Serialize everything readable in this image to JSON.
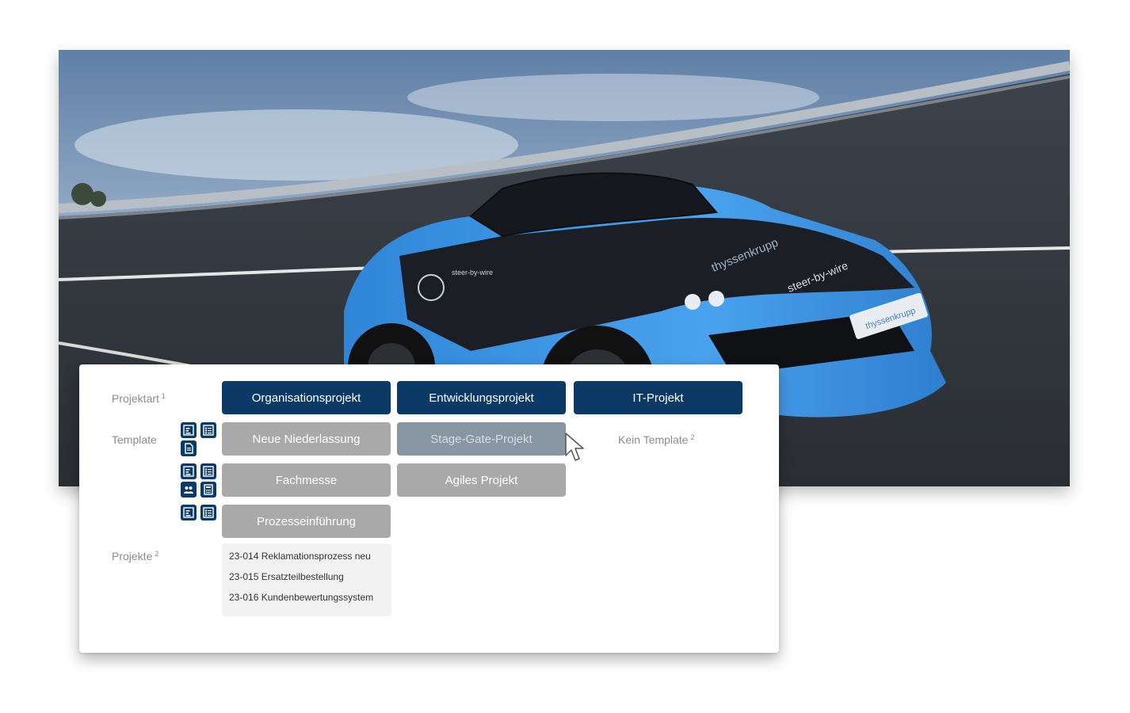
{
  "hero": {
    "car_hood_text": "thyssenkrupp",
    "car_side_text": "steer-by-wire",
    "plate_text": "thyssenkrupp"
  },
  "labels": {
    "projektart": "Projektart",
    "projektart_note": "1",
    "template": "Template",
    "projekte": "Projekte",
    "projekte_note": "2"
  },
  "project_types": [
    {
      "label": "Organisationsprojekt"
    },
    {
      "label": "Entwicklungsprojekt"
    },
    {
      "label": "IT-Projekt"
    }
  ],
  "templates": [
    {
      "label": "Neue Niederlassung"
    },
    {
      "label": "Stage-Gate-Projekt"
    },
    {
      "label": "Fachmesse"
    },
    {
      "label": "Agiles Projekt"
    },
    {
      "label": "Prozesseinführung"
    }
  ],
  "no_template": {
    "label": "Kein Template",
    "note": "2"
  },
  "projects": [
    "23-014 Reklamationsprozess neu",
    "23-015 Ersatzteilbestellung",
    "23-016 Kundenbewertungssystem"
  ],
  "colors": {
    "primary": "#0b3a66",
    "template_button": "#a9a9a9",
    "template_button_hover": "#8896a3",
    "label_text": "#8c8c8c",
    "project_list_bg": "#f2f2f2"
  },
  "icons": {
    "row1": [
      "chart-icon",
      "checklist-icon",
      "document-icon"
    ],
    "row2": [
      "chart-icon",
      "checklist-icon",
      "team-icon",
      "calculator-icon"
    ],
    "row3": [
      "chart-icon",
      "checklist-icon"
    ]
  }
}
